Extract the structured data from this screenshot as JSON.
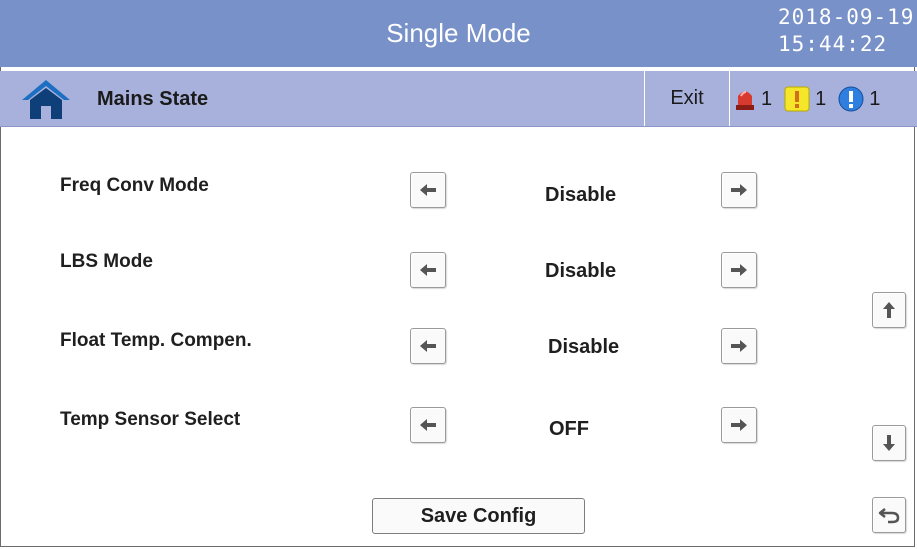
{
  "header": {
    "title": "Single Mode",
    "date": "2018-09-19",
    "time": "15:44:22"
  },
  "subbar": {
    "home_icon": "home-icon",
    "page_name": "Mains State",
    "exit_label": "Exit",
    "alarms": [
      {
        "icon": "red-siren-icon",
        "count": "1",
        "color": "#d83a2f"
      },
      {
        "icon": "yellow-warning-icon",
        "count": "1",
        "color": "#f5e62a"
      },
      {
        "icon": "blue-info-icon",
        "count": "1",
        "color": "#2f7fe0"
      }
    ]
  },
  "settings": [
    {
      "label": "Freq  Conv  Mode",
      "value": "Disable"
    },
    {
      "label": "LBS Mode",
      "value": "Disable"
    },
    {
      "label": "Float Temp. Compen.",
      "value": "Disable"
    },
    {
      "label": "Temp  Sensor Select",
      "value": "OFF"
    }
  ],
  "nav": {
    "prev_icon": "arrow-left-icon",
    "next_icon": "arrow-right-icon",
    "scroll_up_icon": "arrow-up-icon",
    "scroll_down_icon": "arrow-down-icon",
    "back_icon": "return-icon"
  },
  "save_label": "Save Config",
  "colors": {
    "header_bg": "#7891c8",
    "subbar_bg": "#a8b1dc"
  }
}
